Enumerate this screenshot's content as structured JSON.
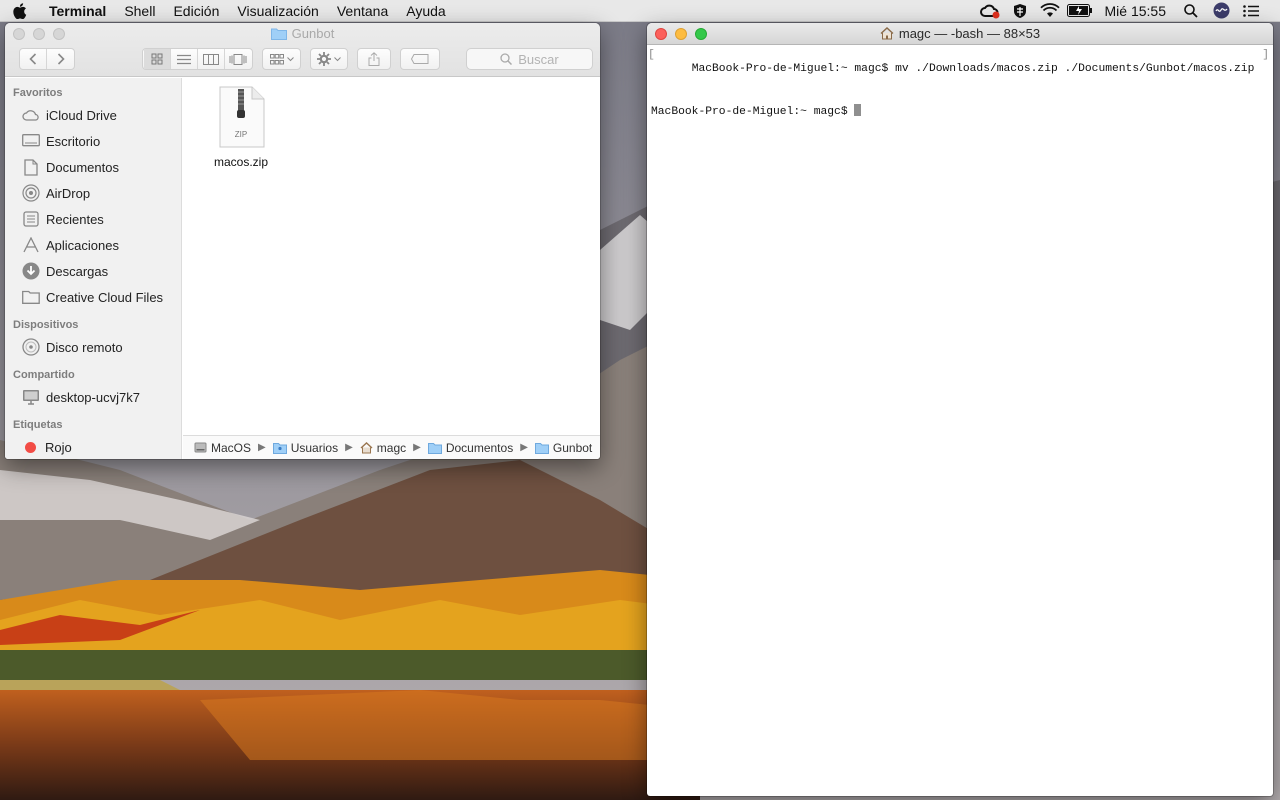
{
  "menubar": {
    "app_name": "Terminal",
    "items": [
      "Shell",
      "Edición",
      "Visualización",
      "Ventana",
      "Ayuda"
    ],
    "clock": "Mié 15:55"
  },
  "finder": {
    "title": "Gunbot",
    "search_placeholder": "Buscar",
    "sidebar": {
      "favorites_header": "Favoritos",
      "favorites": [
        {
          "label": "iCloud Drive",
          "icon": "cloud-icon"
        },
        {
          "label": "Escritorio",
          "icon": "desktop-icon"
        },
        {
          "label": "Documentos",
          "icon": "document-icon"
        },
        {
          "label": "AirDrop",
          "icon": "airdrop-icon"
        },
        {
          "label": "Recientes",
          "icon": "recents-icon"
        },
        {
          "label": "Aplicaciones",
          "icon": "applications-icon"
        },
        {
          "label": "Descargas",
          "icon": "downloads-icon"
        },
        {
          "label": "Creative Cloud Files",
          "icon": "folder-icon"
        }
      ],
      "devices_header": "Dispositivos",
      "devices": [
        {
          "label": "Disco remoto",
          "icon": "disc-icon"
        }
      ],
      "shared_header": "Compartido",
      "shared": [
        {
          "label": "desktop-ucvj7k7",
          "icon": "computer-icon"
        }
      ],
      "tags_header": "Etiquetas",
      "tags": [
        {
          "label": "Rojo",
          "color": "#f24c45"
        }
      ]
    },
    "files": [
      {
        "name": "macos.zip",
        "badge": "ZIP"
      }
    ],
    "path": [
      "MacOS",
      "Usuarios",
      "magc",
      "Documentos",
      "Gunbot"
    ]
  },
  "terminal": {
    "title": "magc — -bash — 88×53",
    "lines": [
      "MacBook-Pro-de-Miguel:~ magc$ mv ./Downloads/macos.zip ./Documents/Gunbot/macos.zip",
      "MacBook-Pro-de-Miguel:~ magc$ "
    ]
  }
}
